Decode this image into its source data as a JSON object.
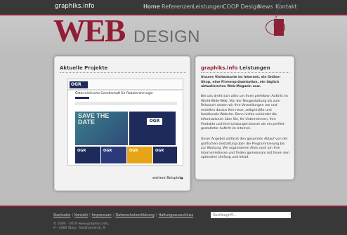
{
  "header": {
    "site_name": "graphiks.info",
    "nav": [
      "Home",
      "Referenzen",
      "Leistungen",
      "COOP Design",
      "News",
      "Kontakt"
    ],
    "active_nav": "Home"
  },
  "hero": {
    "logo_main": "WEB",
    "logo_sub": "DESIGN",
    "stamp_text": "graphiks webdesign"
  },
  "projects": {
    "title": "Aktuelle Projekte",
    "screenshot": {
      "brand": "OGR",
      "headline": "Österreichische Gesellschaft für Roboterchirurgie",
      "banner": "SAVE THE DATE"
    },
    "more_link": "weitere Beispiele",
    "more_arrow": "➜"
  },
  "services": {
    "title_brand": "graphiks.info",
    "title_rest": " Leistungen",
    "paragraphs": [
      "Unsere Visitenkarte im Internet, ein Online-Shop, eine Firmenpräsentation, ein täglich aktualisiertes Web-Magazin usw.",
      "Bei uns dreht sich alles um Ihren perfekten Auftritt im World-Wide-Web. Von der Neugestaltung bis zum Relaunch setzen wir Ihre Vorstellungen um und erstellen daraus Ihre neue, zeitgemäße und funktionale Website. Denn nichts verbindet die Informationen über Sie, Ihr Unternehmen, Ihre Produkte und Ihre Leistungen besser als ein perfekt gestalteter Auftritt im Internet.",
      "Unser Angebot umfasst den gesamten Ablauf von der grafischen Gestaltung über die Programmierung bis zur Wartung. Wir organisieren Alles rund um Ihre Internet-Adresse und finden gemeinsam mit Ihnen den optimalen Umfang und Inhalt."
    ]
  },
  "footer": {
    "links": [
      "Startseite",
      "Kontakt",
      "Impressum",
      "Datenschutzerklärung",
      "Haftungsausschluss"
    ],
    "copyright": "© 2004 - 2019 www.graphiks.info,",
    "address": "A - 4400 Steyr, Stelzhamerstr. 9",
    "search_placeholder": "Suchbegriff...",
    "search_button": "»"
  },
  "colors": {
    "brand_red": "#8e1f36",
    "topbar": "#383838",
    "panel": "#f2f2f2"
  }
}
